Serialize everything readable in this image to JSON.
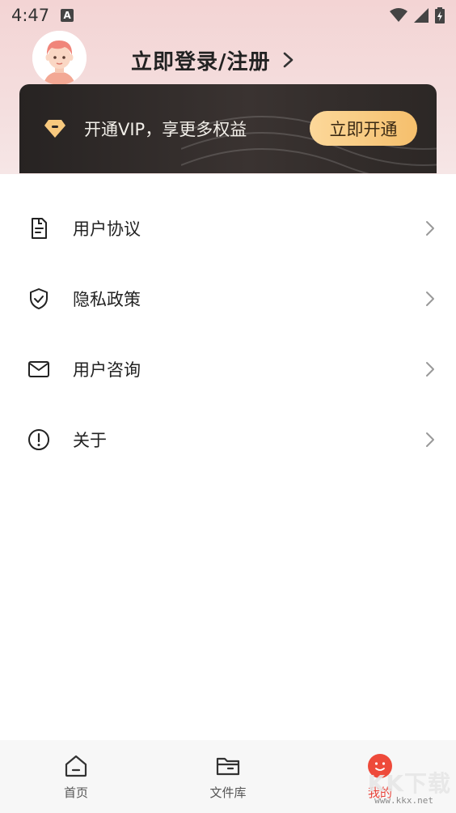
{
  "status_bar": {
    "time": "4:47",
    "notification_icon": "a-icon",
    "icons": [
      "wifi-icon",
      "signal-icon",
      "battery-icon"
    ]
  },
  "profile": {
    "avatar_icon": "avatar-cartoon-icon",
    "login_label": "立即登录/注册"
  },
  "vip": {
    "icon": "diamond-icon",
    "text": "开通VIP，享更多权益",
    "button_label": "立即开通",
    "colors": {
      "card": "#2c2725",
      "button": "#f8c97e"
    }
  },
  "menu": {
    "items": [
      {
        "label": "用户协议",
        "icon": "document-icon"
      },
      {
        "label": "隐私政策",
        "icon": "shield-check-icon"
      },
      {
        "label": "用户咨询",
        "icon": "mail-icon"
      },
      {
        "label": "关于",
        "icon": "info-icon"
      }
    ]
  },
  "tabbar": {
    "tabs": [
      {
        "label": "首页",
        "icon": "home-icon",
        "active": false
      },
      {
        "label": "文件库",
        "icon": "folder-icon",
        "active": false
      },
      {
        "label": "我的",
        "icon": "profile-face-icon",
        "active": true
      }
    ],
    "active_color": "#e8443a"
  },
  "watermark": {
    "big": "KK下载",
    "small": "www.kkx.net"
  }
}
